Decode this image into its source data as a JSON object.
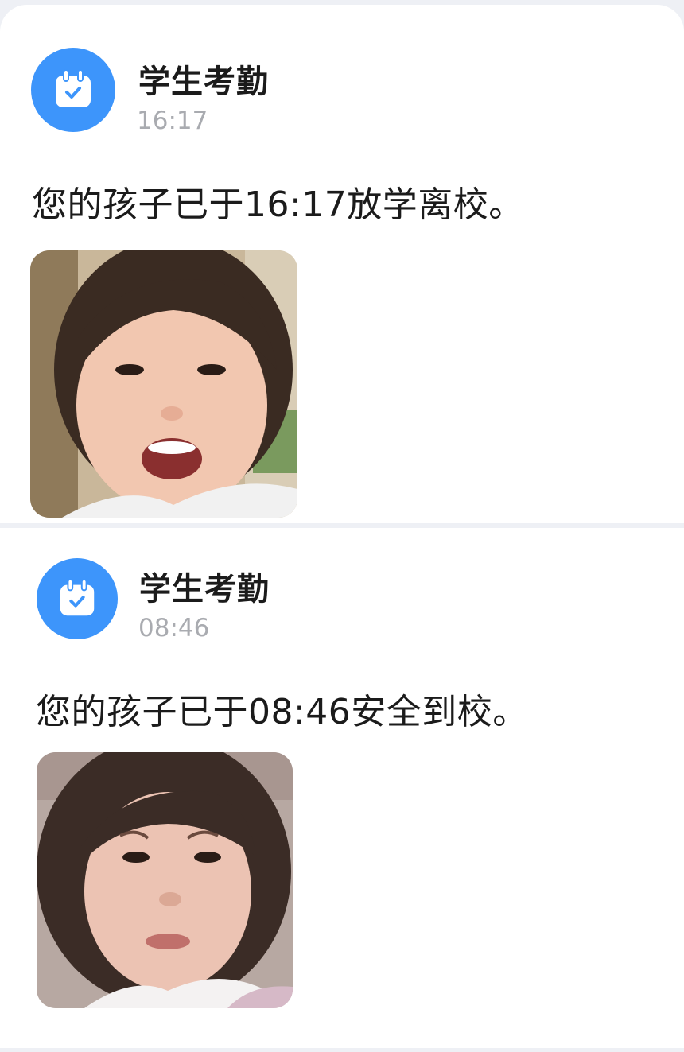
{
  "accent_color": "#3d95fb",
  "messages": [
    {
      "sender": "学生考勤",
      "icon": "calendar-check-icon",
      "time": "16:17",
      "text": "您的孩子已于16:17放学离校。",
      "photo": "child-face-photo-smiling"
    },
    {
      "sender": "学生考勤",
      "icon": "calendar-check-icon",
      "time": "08:46",
      "text": "您的孩子已于08:46安全到校。",
      "photo": "child-face-photo-frowning"
    }
  ]
}
